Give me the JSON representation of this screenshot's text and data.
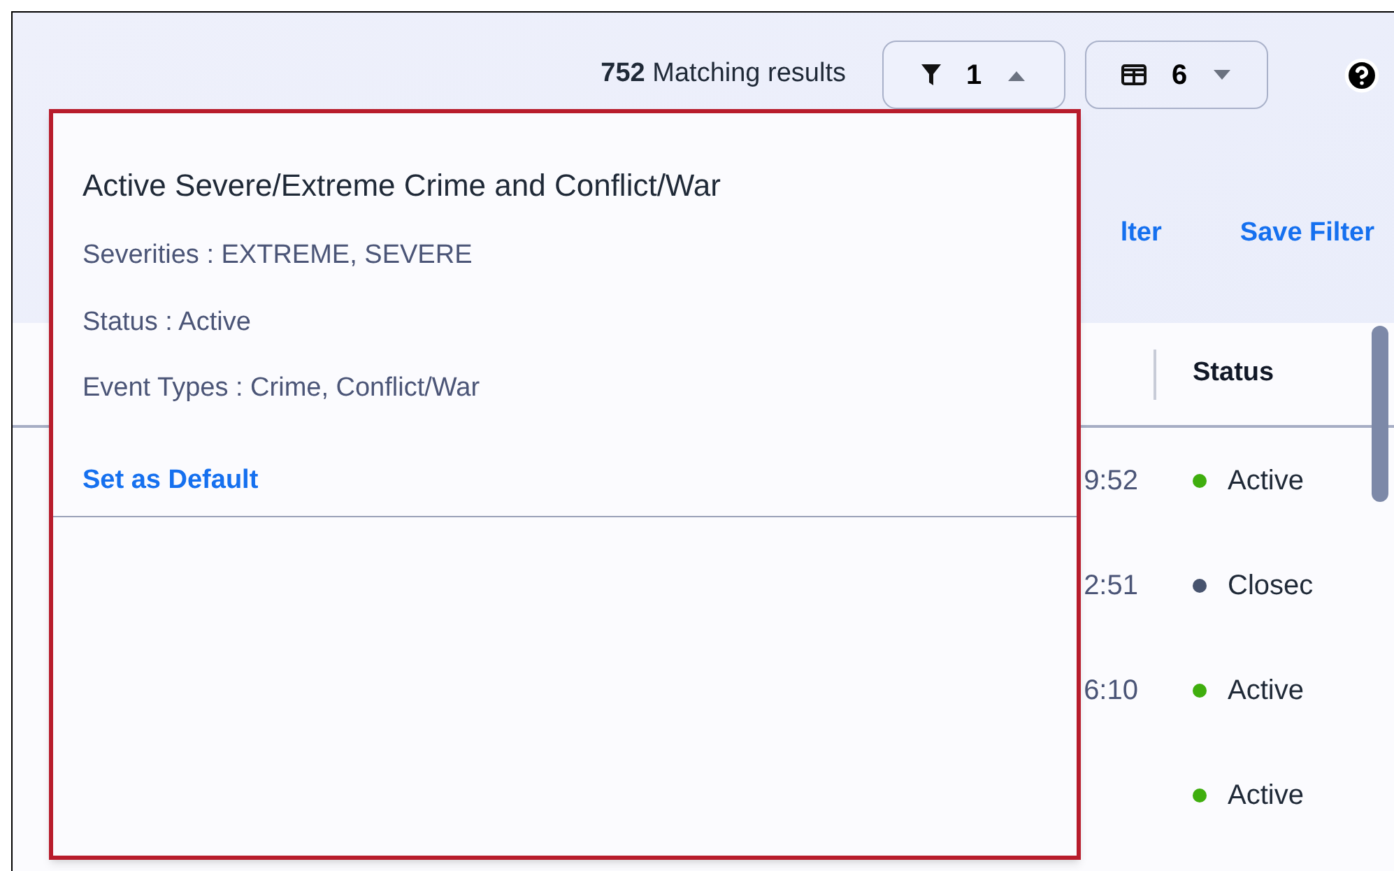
{
  "toolbar": {
    "result_count": "752",
    "result_label": "Matching results",
    "filter_button": {
      "count": "1",
      "expanded": true
    },
    "columns_button": {
      "count": "6",
      "expanded": false
    }
  },
  "filter_actions": [
    {
      "label": "lter"
    },
    {
      "label": "Save Filter"
    }
  ],
  "table": {
    "columns": [
      {
        "label": "Status"
      }
    ],
    "rows": [
      {
        "time": "9:52",
        "status": "Active",
        "color": "#3fae0e"
      },
      {
        "time": "2:51",
        "status": "Closec",
        "color": "#47536e"
      },
      {
        "time": "6:10",
        "status": "Active",
        "color": "#3fae0e"
      },
      {
        "status": "Active",
        "color": "#3fae0e"
      }
    ]
  },
  "popup": {
    "title": "Active Severe/Extreme Crime and Conflict/War",
    "details": [
      "Severities : EXTREME, SEVERE",
      "Status : Active",
      "Event Types : Crime, Conflict/War"
    ],
    "link": "Set as Default"
  }
}
